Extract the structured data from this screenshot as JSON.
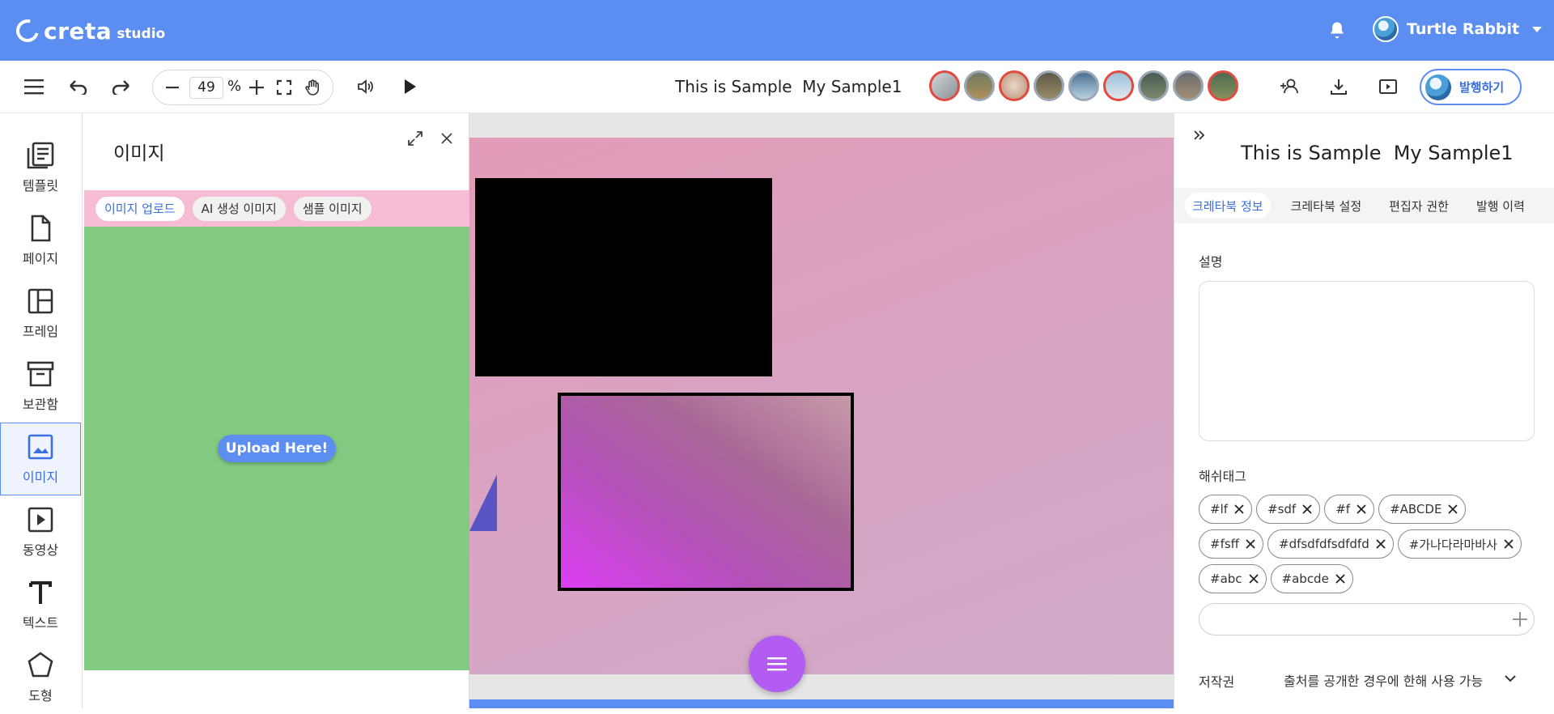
{
  "header": {
    "logo_text": "creta",
    "logo_sub": "studio",
    "user_name": "Turtle Rabbit"
  },
  "toolbar": {
    "zoom_value": "49",
    "zoom_unit": "%",
    "document_title": "This is Sample  My Sample1",
    "publish_label": "발행하기"
  },
  "leftnav": {
    "items": [
      {
        "label": "템플릿",
        "icon": "template-icon"
      },
      {
        "label": "페이지",
        "icon": "page-icon"
      },
      {
        "label": "프레임",
        "icon": "frame-icon"
      },
      {
        "label": "보관함",
        "icon": "archive-icon"
      },
      {
        "label": "이미지",
        "icon": "image-icon",
        "active": true
      },
      {
        "label": "동영상",
        "icon": "video-icon"
      },
      {
        "label": "텍스트",
        "icon": "text-icon"
      },
      {
        "label": "도형",
        "icon": "shape-icon"
      }
    ]
  },
  "image_panel": {
    "title": "이미지",
    "chips": [
      "이미지 업로드",
      "AI 생성 이미지",
      "샘플 이미지"
    ],
    "upload_label": "Upload Here!"
  },
  "right_panel": {
    "title": "This is Sample  My Sample1",
    "tabs": [
      "크레타북 정보",
      "크레타북 설정",
      "편집자 권한",
      "발행 이력"
    ],
    "description_label": "설명",
    "hashtag_label": "해쉬태그",
    "tags": [
      "#lf",
      "#sdf",
      "#f",
      "#ABCDE",
      "#fsff",
      "#dfsdfdfsdfdfd",
      "#가나다라마바사",
      "#abc",
      "#abcde"
    ],
    "copyright_label": "저작권",
    "copyright_value": "출처를 공개한 경우에 한해 사용 가능"
  },
  "colors": {
    "brand": "#5b8ef0",
    "fab": "#b35cf2",
    "upload_area": "#82c982",
    "chip_bar": "#f6bcd3"
  }
}
